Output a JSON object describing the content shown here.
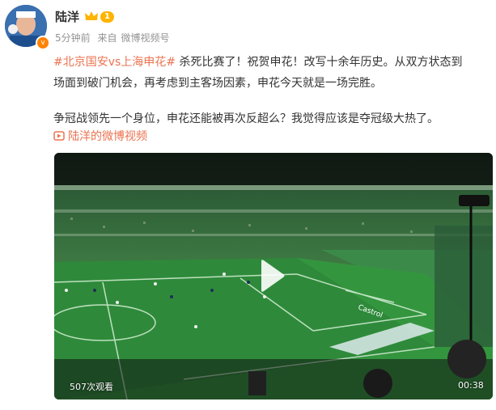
{
  "post": {
    "author": "陆洋",
    "level": "1",
    "time": "5分钟前",
    "source_prefix": "来自",
    "source": "微博视频号",
    "hashtag": "#北京国安vs上海申花#",
    "line1_rest": " 杀死比赛了！祝贺申花！改写十余年历史。从双方状态到",
    "line2": "场面到破门机会，再考虑到主客场因素，申花今天就是一场完胜。",
    "line3": "争冠战领先一个身位，申花还能被再次反超么？我觉得应该是夺冠级大热了。",
    "video_link": "陆洋的微博视频"
  },
  "video": {
    "views": "507次观看",
    "duration": "00:38"
  },
  "colors": {
    "accent": "#eb7350",
    "pitch": "#2e8a3a",
    "crowd": "#1f5a2e"
  }
}
